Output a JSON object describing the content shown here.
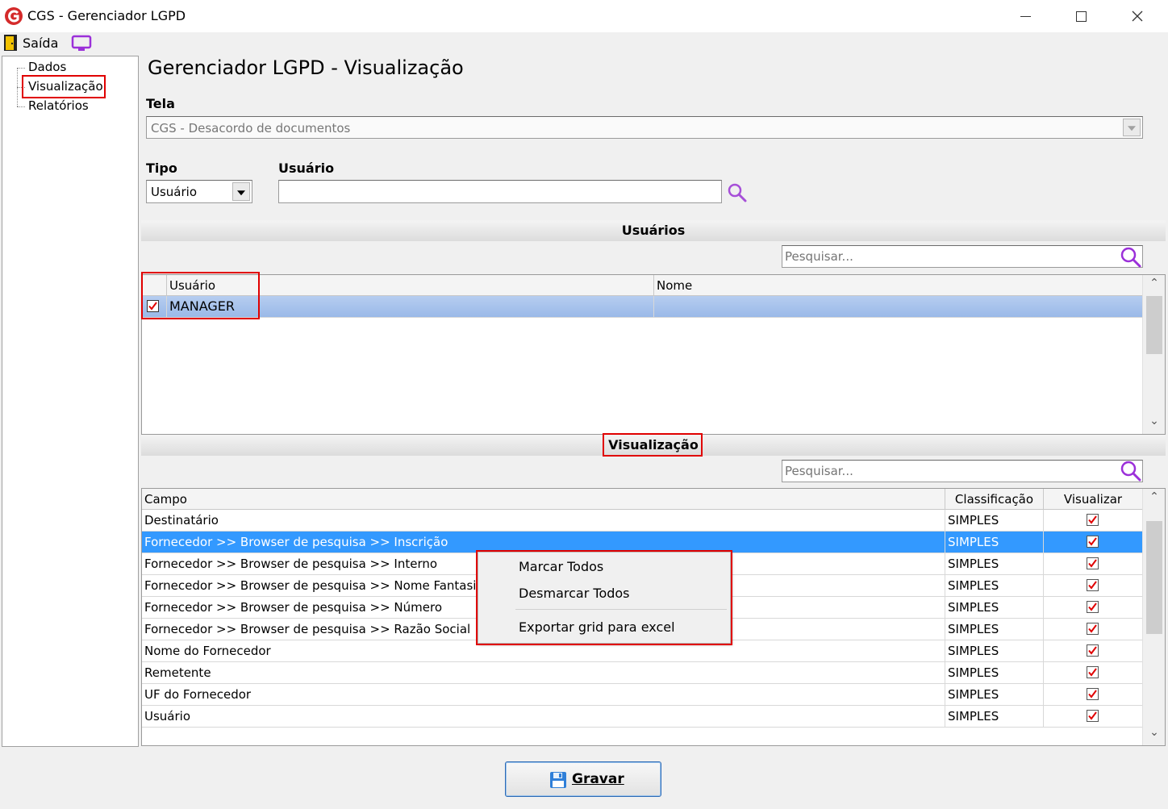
{
  "window": {
    "title": "CGS - Gerenciador LGPD"
  },
  "menu": {
    "exit_label": "Saída"
  },
  "nav": {
    "items": [
      {
        "label": "Dados"
      },
      {
        "label": "Visualização"
      },
      {
        "label": "Relatórios"
      }
    ]
  },
  "page": {
    "title": "Gerenciador LGPD - Visualização"
  },
  "form": {
    "tela_label": "Tela",
    "tela_value": "CGS - Desacordo de documentos",
    "tipo_label": "Tipo",
    "tipo_value": "Usuário",
    "usuario_label": "Usuário",
    "usuario_value": ""
  },
  "users_section": {
    "title": "Usuários",
    "search_placeholder": "Pesquisar...",
    "columns": [
      "Usuário",
      "Nome"
    ],
    "rows": [
      {
        "usuario": "MANAGER",
        "nome": "",
        "checked": true
      }
    ]
  },
  "view_section": {
    "title": "Visualização",
    "search_placeholder": "Pesquisar...",
    "columns": [
      "Campo",
      "Classificação",
      "Visualizar"
    ],
    "rows": [
      {
        "campo": "Destinatário",
        "classificacao": "SIMPLES",
        "visualizar": true
      },
      {
        "campo": "Fornecedor >> Browser de pesquisa >> Inscrição",
        "classificacao": "SIMPLES",
        "visualizar": true
      },
      {
        "campo": "Fornecedor >> Browser de pesquisa >> Interno",
        "classificacao": "SIMPLES",
        "visualizar": true
      },
      {
        "campo": "Fornecedor >> Browser de pesquisa >> Nome Fantasia",
        "classificacao": "SIMPLES",
        "visualizar": true
      },
      {
        "campo": "Fornecedor >> Browser de pesquisa >> Número",
        "classificacao": "SIMPLES",
        "visualizar": true
      },
      {
        "campo": "Fornecedor >> Browser de pesquisa >> Razão Social",
        "classificacao": "SIMPLES",
        "visualizar": true
      },
      {
        "campo": "Nome do Fornecedor",
        "classificacao": "SIMPLES",
        "visualizar": true
      },
      {
        "campo": "Remetente",
        "classificacao": "SIMPLES",
        "visualizar": true
      },
      {
        "campo": "UF do Fornecedor",
        "classificacao": "SIMPLES",
        "visualizar": true
      },
      {
        "campo": "Usuário",
        "classificacao": "SIMPLES",
        "visualizar": true
      }
    ],
    "selected_row": 1
  },
  "context_menu": {
    "items": [
      "Marcar Todos",
      "Desmarcar Todos",
      "Exportar grid para excel"
    ]
  },
  "footer": {
    "save_label": "Gravar"
  },
  "colors": {
    "highlight_red": "#e00000",
    "selection_blue": "#3399ff",
    "accent_purple": "#9b30d9"
  }
}
